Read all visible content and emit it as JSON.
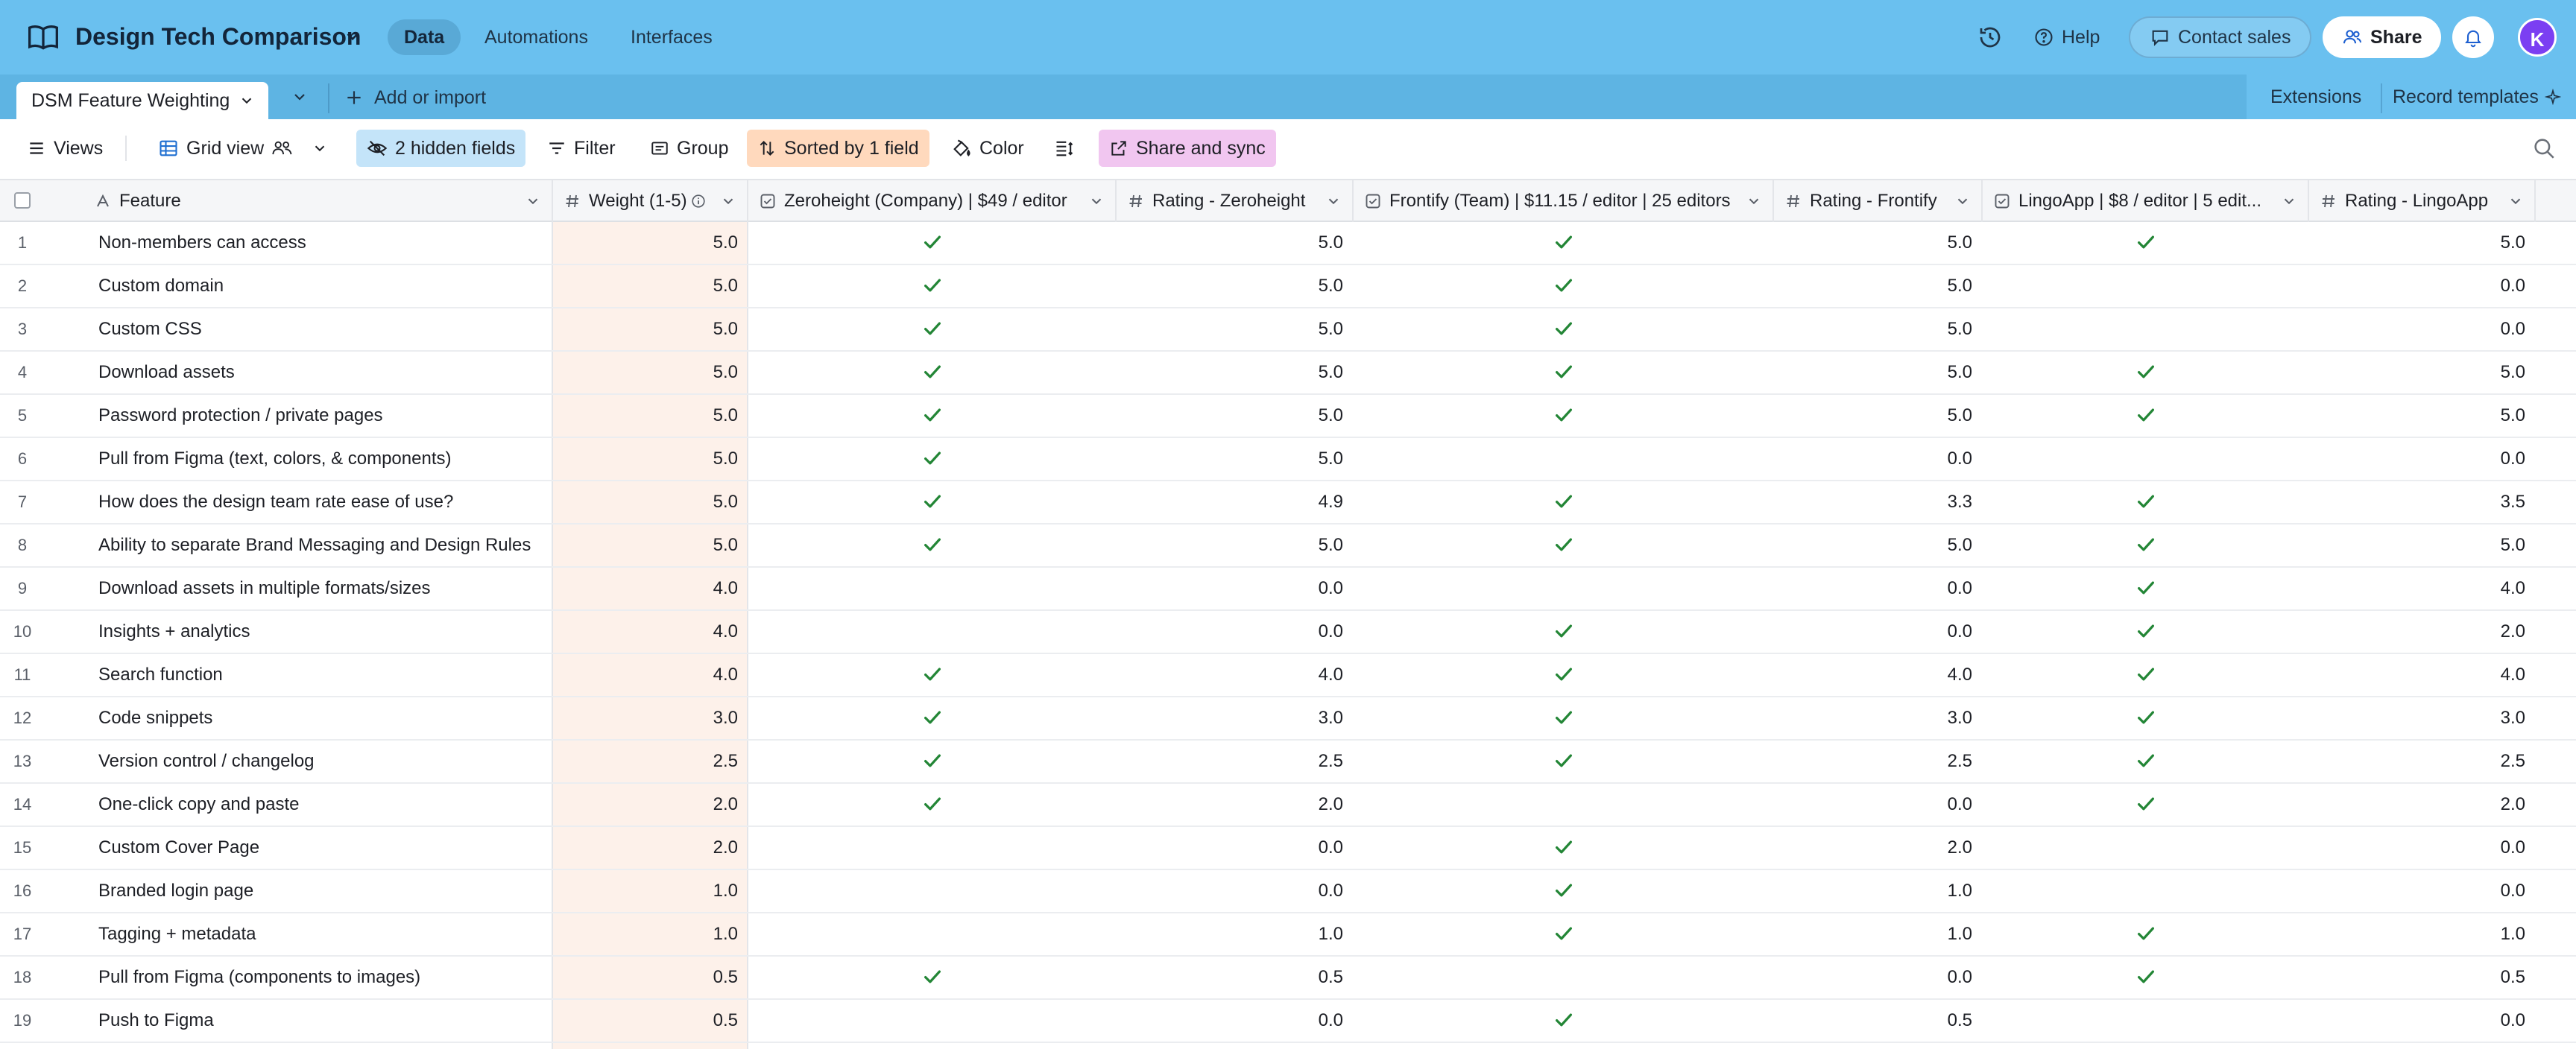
{
  "app": {
    "base_title": "Design Tech Comparison",
    "nav_tabs": [
      "Data",
      "Automations",
      "Interfaces"
    ],
    "help_label": "Help",
    "contact_label": "Contact sales",
    "share_label": "Share",
    "avatar_initial": "K",
    "accent_color": "#6ac0ef"
  },
  "tablebar": {
    "active_table": "DSM Feature Weighting",
    "add_import_label": "Add or import",
    "extensions_label": "Extensions",
    "record_templates_label": "Record templates"
  },
  "toolbar": {
    "views_label": "Views",
    "view_name": "Grid view",
    "hidden_fields_label": "2 hidden fields",
    "filter_label": "Filter",
    "group_label": "Group",
    "sort_label": "Sorted by 1 field",
    "color_label": "Color",
    "share_sync_label": "Share and sync"
  },
  "columns": [
    {
      "label": "Feature",
      "type": "text"
    },
    {
      "label": "Weight (1-5)",
      "type": "number"
    },
    {
      "label": "Zeroheight (Company) | $49 / editor",
      "type": "checkbox"
    },
    {
      "label": "Rating - Zeroheight",
      "type": "number"
    },
    {
      "label": "Frontify (Team) | $11.15 / editor | 25 editors",
      "type": "checkbox"
    },
    {
      "label": "Rating - Frontify",
      "type": "number"
    },
    {
      "label": "LingoApp | $8 / editor | 5 edit...",
      "type": "checkbox"
    },
    {
      "label": "Rating - LingoApp",
      "type": "number"
    }
  ],
  "rows": [
    {
      "n": "1",
      "feature": "Non-members can access",
      "weight": "5.0",
      "zh": true,
      "rz": "5.0",
      "fr": true,
      "rf": "5.0",
      "li": true,
      "rl": "5.0"
    },
    {
      "n": "2",
      "feature": "Custom domain",
      "weight": "5.0",
      "zh": true,
      "rz": "5.0",
      "fr": true,
      "rf": "5.0",
      "li": false,
      "rl": "0.0"
    },
    {
      "n": "3",
      "feature": "Custom CSS",
      "weight": "5.0",
      "zh": true,
      "rz": "5.0",
      "fr": true,
      "rf": "5.0",
      "li": false,
      "rl": "0.0"
    },
    {
      "n": "4",
      "feature": "Download assets",
      "weight": "5.0",
      "zh": true,
      "rz": "5.0",
      "fr": true,
      "rf": "5.0",
      "li": true,
      "rl": "5.0"
    },
    {
      "n": "5",
      "feature": "Password protection / private pages",
      "weight": "5.0",
      "zh": true,
      "rz": "5.0",
      "fr": true,
      "rf": "5.0",
      "li": true,
      "rl": "5.0"
    },
    {
      "n": "6",
      "feature": "Pull from Figma (text, colors, & components)",
      "weight": "5.0",
      "zh": true,
      "rz": "5.0",
      "fr": false,
      "rf": "0.0",
      "li": false,
      "rl": "0.0"
    },
    {
      "n": "7",
      "feature": "How does the design team rate ease of use?",
      "weight": "5.0",
      "zh": true,
      "rz": "4.9",
      "fr": true,
      "rf": "3.3",
      "li": true,
      "rl": "3.5"
    },
    {
      "n": "8",
      "feature": "Ability to separate Brand Messaging and Design Rules",
      "weight": "5.0",
      "zh": true,
      "rz": "5.0",
      "fr": true,
      "rf": "5.0",
      "li": true,
      "rl": "5.0"
    },
    {
      "n": "9",
      "feature": "Download assets in multiple formats/sizes",
      "weight": "4.0",
      "zh": false,
      "rz": "0.0",
      "fr": false,
      "rf": "0.0",
      "li": true,
      "rl": "4.0"
    },
    {
      "n": "10",
      "feature": "Insights + analytics",
      "weight": "4.0",
      "zh": false,
      "rz": "0.0",
      "fr": true,
      "rf": "0.0",
      "li": true,
      "rl": "2.0"
    },
    {
      "n": "11",
      "feature": "Search function",
      "weight": "4.0",
      "zh": true,
      "rz": "4.0",
      "fr": true,
      "rf": "4.0",
      "li": true,
      "rl": "4.0"
    },
    {
      "n": "12",
      "feature": "Code snippets",
      "weight": "3.0",
      "zh": true,
      "rz": "3.0",
      "fr": true,
      "rf": "3.0",
      "li": true,
      "rl": "3.0"
    },
    {
      "n": "13",
      "feature": "Version control / changelog",
      "weight": "2.5",
      "zh": true,
      "rz": "2.5",
      "fr": true,
      "rf": "2.5",
      "li": true,
      "rl": "2.5"
    },
    {
      "n": "14",
      "feature": "One-click copy and paste",
      "weight": "2.0",
      "zh": true,
      "rz": "2.0",
      "fr": false,
      "rf": "0.0",
      "li": true,
      "rl": "2.0"
    },
    {
      "n": "15",
      "feature": "Custom Cover Page",
      "weight": "2.0",
      "zh": false,
      "rz": "0.0",
      "fr": true,
      "rf": "2.0",
      "li": false,
      "rl": "0.0"
    },
    {
      "n": "16",
      "feature": "Branded login page",
      "weight": "1.0",
      "zh": false,
      "rz": "0.0",
      "fr": true,
      "rf": "1.0",
      "li": false,
      "rl": "0.0"
    },
    {
      "n": "17",
      "feature": "Tagging + metadata",
      "weight": "1.0",
      "zh": false,
      "rz": "1.0",
      "fr": true,
      "rf": "1.0",
      "li": true,
      "rl": "1.0"
    },
    {
      "n": "18",
      "feature": "Pull from Figma (components to images)",
      "weight": "0.5",
      "zh": true,
      "rz": "0.5",
      "fr": false,
      "rf": "0.0",
      "li": true,
      "rl": "0.5"
    },
    {
      "n": "19",
      "feature": "Push to Figma",
      "weight": "0.5",
      "zh": false,
      "rz": "0.0",
      "fr": true,
      "rf": "0.5",
      "li": false,
      "rl": "0.0"
    }
  ],
  "check_color": "#238636"
}
